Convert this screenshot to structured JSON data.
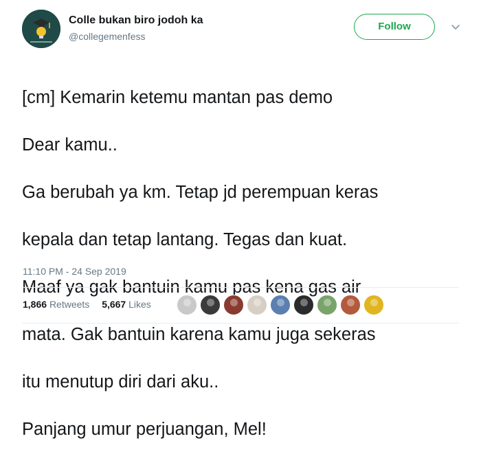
{
  "account": {
    "display_name": "Colle bukan biro jodoh ka",
    "handle": "@collegemenfess",
    "avatar_icon": "graduation-cap-bulb-icon"
  },
  "follow_button": {
    "label": "Follow",
    "color": "#1da84f"
  },
  "tweet": {
    "lines": [
      "[cm] Kemarin ketemu mantan pas demo",
      "Dear kamu..",
      "Ga berubah ya km. Tetap jd perempuan keras",
      "kepala dan tetap lantang. Tegas dan kuat.",
      "Maaf ya gak bantuin kamu pas kena gas air",
      "mata. Gak bantuin karena kamu juga sekeras",
      "itu menutup diri dari aku..",
      "Panjang umur perjuangan, Mel!"
    ],
    "timestamp": "11:10 PM - 24 Sep 2019"
  },
  "stats": {
    "retweets_count": "1,866",
    "retweets_label": "Retweets",
    "likes_count": "5,667",
    "likes_label": "Likes"
  },
  "liker_avatars": [
    {
      "color": "#c9c9c9"
    },
    {
      "color": "#3a3a3a"
    },
    {
      "color": "#8a3b2f"
    },
    {
      "color": "#d7cfc4"
    },
    {
      "color": "#5b7fb0"
    },
    {
      "color": "#2b2b2b"
    },
    {
      "color": "#7aa36b"
    },
    {
      "color": "#b35a3d"
    },
    {
      "color": "#e1b51f"
    }
  ],
  "colors": {
    "text": "#14171a",
    "secondary": "#657786",
    "divider": "#e6ecf0"
  }
}
